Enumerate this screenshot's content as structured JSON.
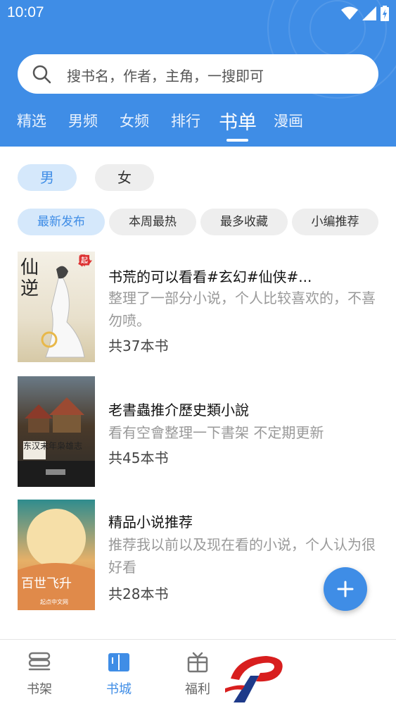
{
  "status": {
    "time": "10:07"
  },
  "search": {
    "placeholder": "搜书名，作者，主角，一搜即可"
  },
  "tabs": [
    {
      "label": "精选"
    },
    {
      "label": "男频"
    },
    {
      "label": "女频"
    },
    {
      "label": "排行"
    },
    {
      "label": "书单"
    },
    {
      "label": "漫画"
    }
  ],
  "active_tab": "书单",
  "gender": {
    "male": "男",
    "female": "女",
    "selected": "男"
  },
  "filters": [
    {
      "label": "最新发布"
    },
    {
      "label": "本周最热"
    },
    {
      "label": "最多收藏"
    },
    {
      "label": "小编推荐"
    }
  ],
  "booklists": [
    {
      "title": "书荒的可以看看#玄幻#仙侠#...",
      "desc": "整理了一部分小说，个人比较喜欢的，不喜勿喷。",
      "count": "共37本书",
      "cover": {
        "text": "仙逆",
        "badge": "起"
      }
    },
    {
      "title": "老書蟲推介歷史類小說",
      "desc": "看有空會整理一下書架 不定期更新",
      "count": "共45本书",
      "cover": {
        "text": "东汉末年枭雄志"
      }
    },
    {
      "title": "精品小说推荐",
      "desc": "推荐我以前以及现在看的小说，个人认为很好看",
      "count": "共28本书",
      "cover": {
        "text": "百世飞升",
        "footer": "起点中文网"
      }
    }
  ],
  "bottom_nav": [
    {
      "label": "书架",
      "icon": "bookshelf-icon"
    },
    {
      "label": "书城",
      "icon": "book-open-icon"
    },
    {
      "label": "福利",
      "icon": "gift-icon"
    }
  ],
  "active_nav": "书城",
  "colors": {
    "primary": "#3f8de6",
    "chip_active_bg": "#d5e8fb",
    "chip_bg": "#eeeeee"
  }
}
